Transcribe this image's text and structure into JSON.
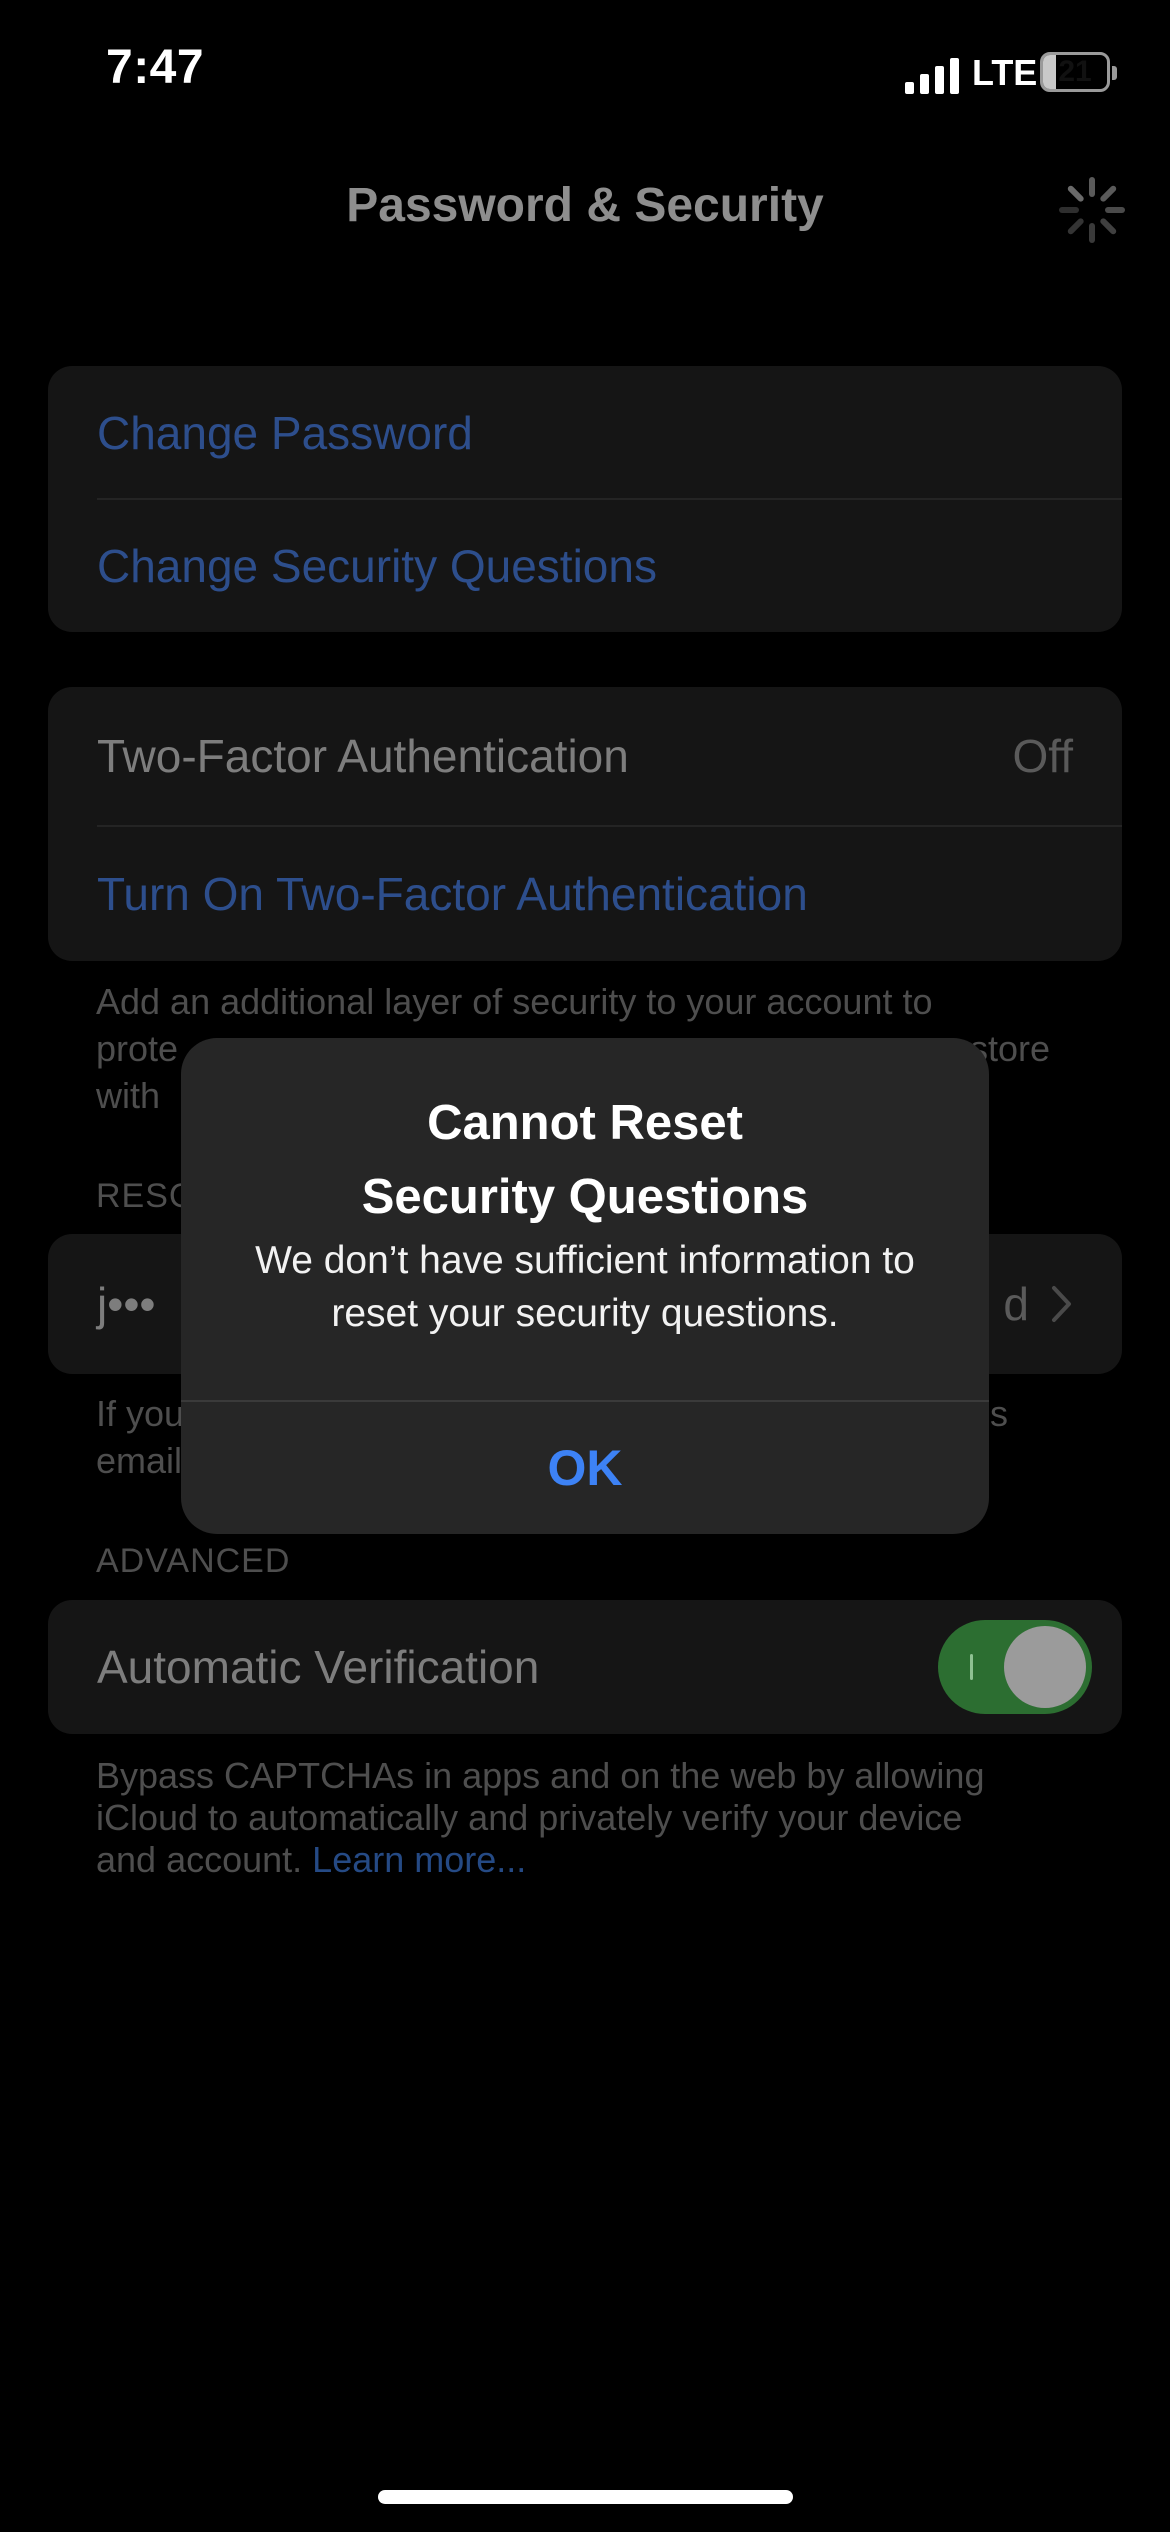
{
  "status_bar": {
    "time": "7:47",
    "network": "LTE",
    "battery_level": "21",
    "battery_fraction": 0.21
  },
  "nav": {
    "title": "Password & Security",
    "activity_icon": "spinner-icon"
  },
  "account_group": {
    "change_password": "Change Password",
    "change_security_questions": "Change Security Questions"
  },
  "two_factor_group": {
    "label": "Two-Factor Authentication",
    "value": "Off",
    "turn_on": "Turn On Two-Factor Authentication",
    "footer_line1": "Add an additional layer of security to your account to",
    "footer_line2_start": "prote",
    "footer_line2_end": "store",
    "footer_line3": "with"
  },
  "rescue_section": {
    "header_partial": "RESC",
    "email_start": "j•••",
    "email_end": "d",
    "footer_line1_start": "If you",
    "footer_line1_end": "s",
    "footer_line2_start": "email"
  },
  "advanced_section": {
    "header": "ADVANCED",
    "label": "Automatic Verification",
    "toggle_on": true,
    "footer_line1": "Bypass CAPTCHAs in apps and on the web by allowing",
    "footer_line2": "iCloud to automatically and privately verify your device",
    "footer_line3": "and account.",
    "learn_more": "Learn more..."
  },
  "alert": {
    "title_line1": "Cannot Reset",
    "title_line2": "Security Questions",
    "message_line1": "We don’t have sufficient information to",
    "message_line2": "reset your security questions.",
    "button": "OK"
  },
  "colors": {
    "link_dimmed": "#2d4e8c",
    "alert_button": "#3d82f5",
    "toggle_on": "#2c6e31"
  }
}
